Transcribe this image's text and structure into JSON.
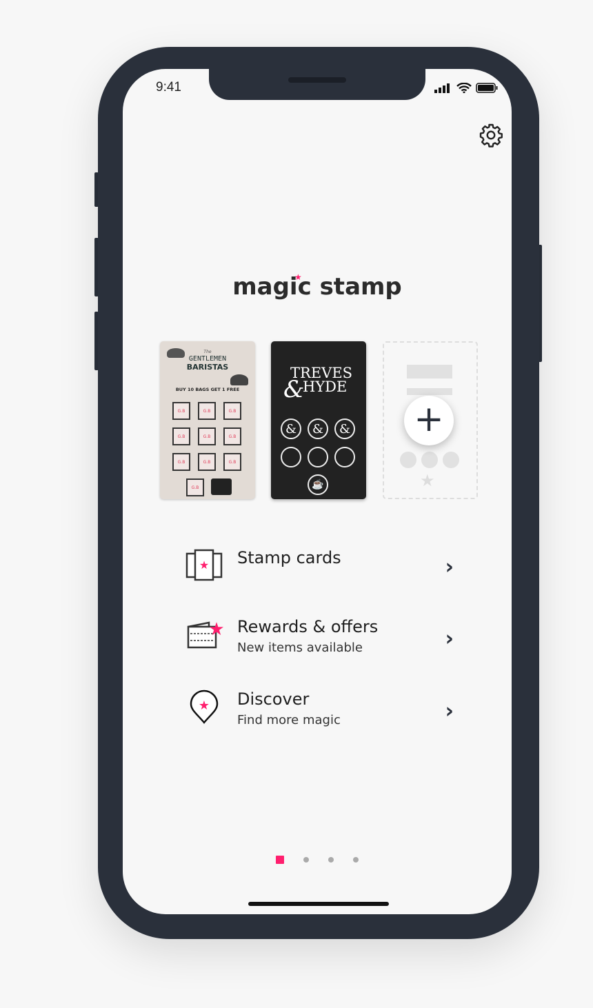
{
  "status_bar": {
    "time": "9:41"
  },
  "app": {
    "logo": "magic stamp",
    "accent": "#ff1f6e"
  },
  "cards": [
    {
      "name": "Gentlemen Baristas",
      "title_small": "The",
      "title1": "GENTLEMEN",
      "title2": "BARISTAS",
      "offer": "BUY 10 BAGS GET 1 FREE",
      "stamp_text": "G.B"
    },
    {
      "name": "Treves & Hyde",
      "title1": "TREVES",
      "title2": "HYDE",
      "amp": "&",
      "stamps_filled": 3,
      "stamps_total": 6
    },
    {
      "name": "add-card",
      "icon": "plus-icon"
    }
  ],
  "menu": [
    {
      "title": "Stamp cards",
      "subtitle": "",
      "icon": "stamp-cards-icon"
    },
    {
      "title": "Rewards & offers",
      "subtitle": "New items available",
      "icon": "rewards-ticket-icon"
    },
    {
      "title": "Discover",
      "subtitle": "Find more magic",
      "icon": "location-pin-star-icon"
    }
  ],
  "pagination": {
    "current": 1,
    "total": 4
  }
}
